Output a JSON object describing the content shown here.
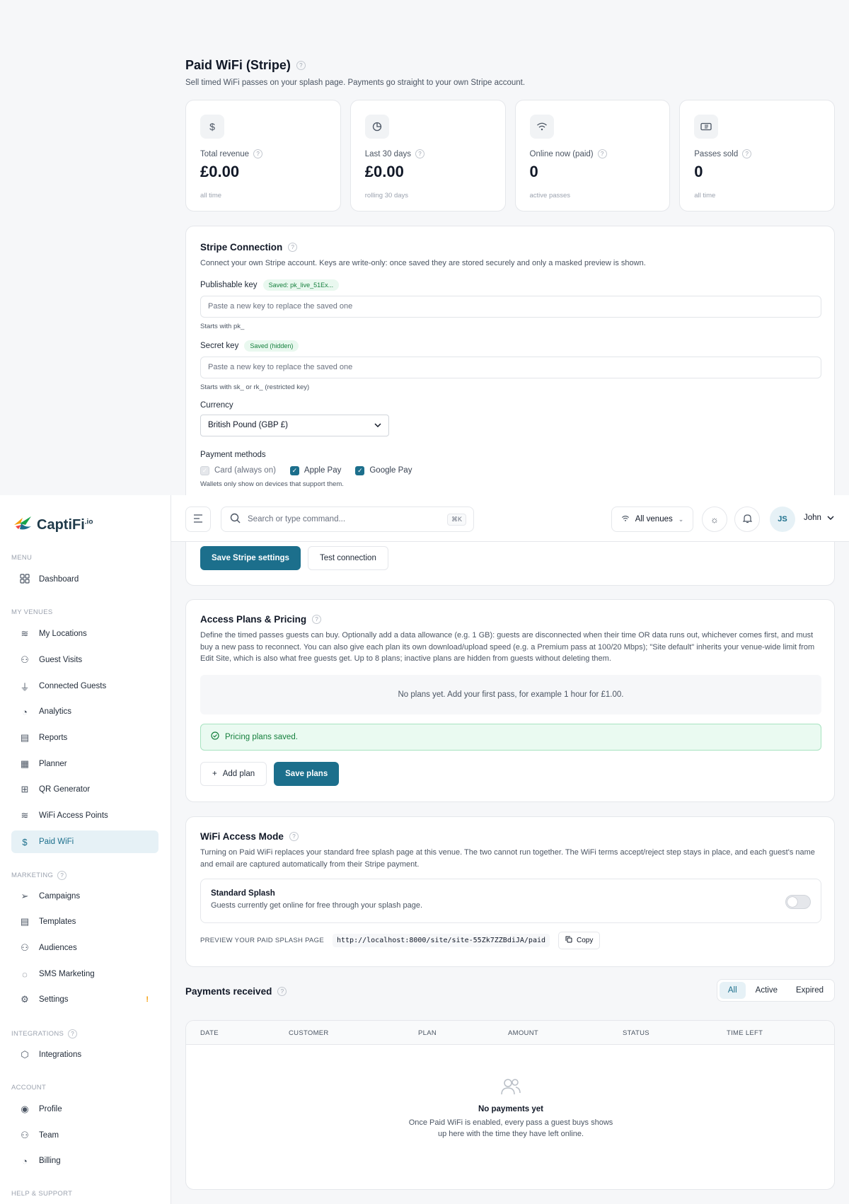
{
  "page": {
    "title": "Paid WiFi (Stripe)",
    "subtitle": "Sell timed WiFi passes on your splash page. Payments go straight to your own Stripe account."
  },
  "stats": [
    {
      "icon": "dollar-icon",
      "label": "Total revenue",
      "value": "£0.00",
      "note": "all time"
    },
    {
      "icon": "pie-chart-icon",
      "label": "Last 30 days",
      "value": "£0.00",
      "note": "rolling 30 days"
    },
    {
      "icon": "wifi-icon",
      "label": "Online now (paid)",
      "value": "0",
      "note": "active passes"
    },
    {
      "icon": "ticket-icon",
      "label": "Passes sold",
      "value": "0",
      "note": "all time"
    }
  ],
  "stripe": {
    "title": "Stripe Connection",
    "description": "Connect your own Stripe account. Keys are write-only: once saved they are stored securely and only a masked preview is shown.",
    "publishable_label": "Publishable key",
    "publishable_badge": "Saved: pk_live_51Ex...",
    "publishable_placeholder": "Paste a new key to replace the saved one",
    "publishable_hint": "Starts with pk_",
    "secret_label": "Secret key",
    "secret_badge": "Saved (hidden)",
    "secret_placeholder": "Paste a new key to replace the saved one",
    "secret_hint": "Starts with sk_ or rk_ (restricted key)",
    "currency_label": "Currency",
    "currency_value": "British Pound (GBP £)",
    "payment_methods_label": "Payment methods",
    "method_card": "Card (always on)",
    "method_apple": "Apple Pay",
    "method_google": "Google Pay",
    "wallet_hint": "Wallets only show on devices that support them.",
    "save_button": "Save Stripe settings",
    "test_button": "Test connection"
  },
  "sidebar": {
    "logo": "CaptiFi",
    "logo_suffix": ".io",
    "menu_label": "MENU",
    "dashboard": "Dashboard",
    "venues_label": "MY VENUES",
    "venues": [
      "My Locations",
      "Guest Visits",
      "Connected Guests",
      "Analytics",
      "Reports",
      "Planner",
      "QR Generator",
      "WiFi Access Points",
      "Paid WiFi"
    ],
    "marketing_label": "MARKETING",
    "marketing": [
      "Campaigns",
      "Templates",
      "Audiences",
      "SMS Marketing",
      "Settings"
    ],
    "integrations_label": "INTEGRATIONS",
    "integrations": [
      "Integrations"
    ],
    "account_label": "ACCOUNT",
    "account": [
      "Profile",
      "Team",
      "Billing"
    ],
    "help_label": "HELP & SUPPORT",
    "settings_warning": "!"
  },
  "topbar": {
    "search_placeholder": "Search or type command...",
    "shortcut": "⌘K",
    "venues": "All venues",
    "avatar_initials": "JS",
    "user_name": "John"
  },
  "plans": {
    "title": "Access Plans & Pricing",
    "description": "Define the timed passes guests can buy. Optionally add a data allowance (e.g. 1 GB): guests are disconnected when their time OR data runs out, whichever comes first, and must buy a new pass to reconnect. You can also give each plan its own download/upload speed (e.g. a Premium pass at 100/20 Mbps); \"Site default\" inherits your venue-wide limit from Edit Site, which is also what free guests get. Up to 8 plans; inactive plans are hidden from guests without deleting them.",
    "empty": "No plans yet. Add your first pass, for example 1 hour for £1.00.",
    "success": "Pricing plans saved.",
    "add_button": "Add plan",
    "save_button": "Save plans"
  },
  "access": {
    "title": "WiFi Access Mode",
    "description": "Turning on Paid WiFi replaces your standard free splash page at this venue. The two cannot run together. The WiFi terms accept/reject step stays in place, and each guest's name and email are captured automatically from their Stripe payment.",
    "mode_title": "Standard Splash",
    "mode_desc": "Guests currently get online for free through your splash page.",
    "preview_label": "PREVIEW YOUR PAID SPLASH PAGE",
    "preview_url": "http://localhost:8000/site/site-55Zk7ZZBdiJA/paid",
    "copy_button": "Copy"
  },
  "payments": {
    "title": "Payments received",
    "tabs": [
      "All",
      "Active",
      "Expired"
    ],
    "columns": [
      "DATE",
      "CUSTOMER",
      "PLAN",
      "AMOUNT",
      "STATUS",
      "TIME LEFT"
    ],
    "empty_title": "No payments yet",
    "empty_desc_line1": "Once Paid WiFi is enabled, every pass a guest buys shows",
    "empty_desc_line2": "up here with the time they have left online."
  },
  "colors": {
    "accent": "#1c6f8c",
    "success": "#15803d",
    "warning": "#f59e0b"
  }
}
